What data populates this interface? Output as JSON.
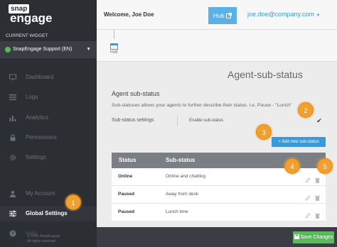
{
  "brand": {
    "top": "snap",
    "bottom": "engage"
  },
  "sidebar": {
    "current_widget_label": "CURRENT WIDGET",
    "widget_name": "SnapEngage Support (EN)",
    "items": [
      {
        "label": "Dashboard",
        "icon": "monitor-icon"
      },
      {
        "label": "Logs",
        "icon": "list-icon"
      },
      {
        "label": "Analytics",
        "icon": "bar-chart-icon"
      },
      {
        "label": "Permissions",
        "icon": "lock-icon"
      },
      {
        "label": "Settings",
        "icon": "gear-icon"
      },
      {
        "label": "My Account",
        "icon": "user-icon"
      },
      {
        "label": "Global Settings",
        "icon": "sliders-icon"
      },
      {
        "label": "Help",
        "icon": "question-icon"
      }
    ],
    "footer_line1": "© 2019 SnapEngage",
    "footer_line2": "All rights reserved"
  },
  "topbar": {
    "welcome": "Welcome, Joe Doe",
    "hub_label": "Hub",
    "user_email": "joe.doe@company.com"
  },
  "hubtab": {
    "label": "HUB"
  },
  "page": {
    "title": "Agent-sub-status",
    "section_title": "Agent sub-status",
    "description": "Sub-statuses allows your agents to further describe their status. I.e. Pause - \"Lunch\"",
    "settings_label": "Sub-status settings",
    "enable_label": "Enable sub-status",
    "add_button": "+ Add new sub-status",
    "save_button": "Save Changes"
  },
  "table": {
    "headers": [
      "Status",
      "Sub-status"
    ],
    "rows": [
      {
        "status": "Online",
        "sub": "Online and chatting"
      },
      {
        "status": "Paused",
        "sub": "Away from desk"
      },
      {
        "status": "Paused",
        "sub": "Lunch time"
      }
    ]
  },
  "callouts": [
    "1",
    "2",
    "3",
    "4",
    "5"
  ],
  "colors": {
    "sidebar_bg": "#2b2e33",
    "accent_blue": "#3a9ad9",
    "hub_blue": "#5bb1e6",
    "save_green": "#5cb85c",
    "callout_orange": "#f0a030",
    "table_header": "#7b7f85"
  }
}
